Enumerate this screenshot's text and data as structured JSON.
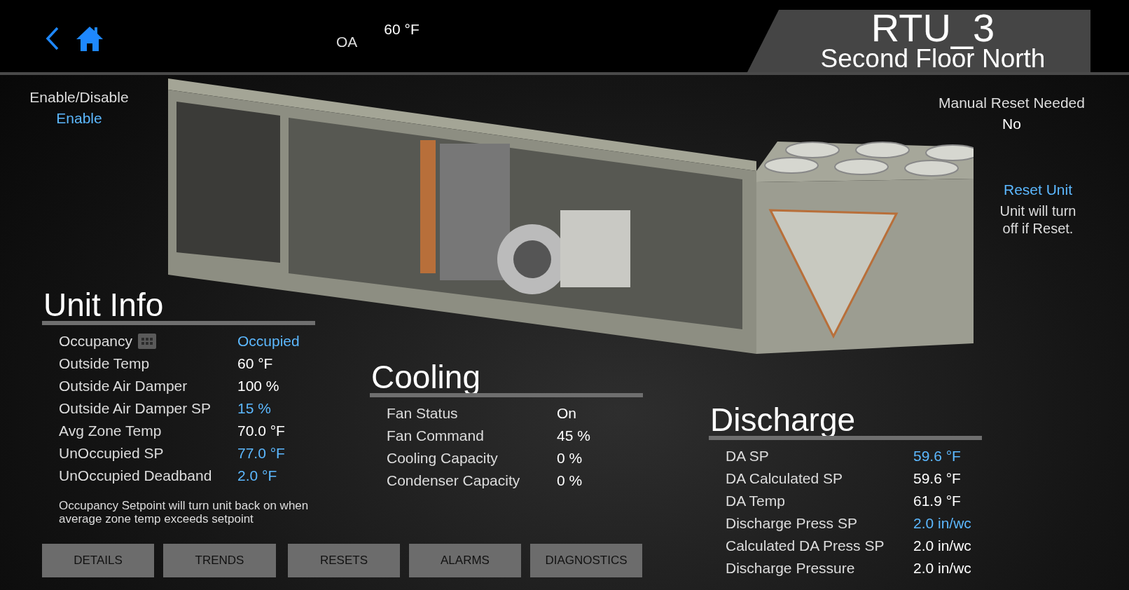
{
  "header": {
    "oa_label": "OA",
    "oa_value": "60 °F",
    "title": "RTU_3",
    "subtitle": "Second Floor North"
  },
  "enable": {
    "label": "Enable/Disable",
    "value": "Enable"
  },
  "manual_reset": {
    "label": "Manual Reset Needed",
    "value": "No"
  },
  "reset": {
    "link": "Reset Unit",
    "note": "Unit will turn off if Reset."
  },
  "unit_info": {
    "title": "Unit Info",
    "rows": [
      {
        "label": "Occupancy",
        "value": "Occupied",
        "editable": true,
        "schedule": true
      },
      {
        "label": "Outside Temp",
        "value": "60 °F",
        "editable": false
      },
      {
        "label": "Outside Air Damper",
        "value": "100 %",
        "editable": false
      },
      {
        "label": "Outside Air Damper SP",
        "value": "15 %",
        "editable": true
      },
      {
        "label": "Avg Zone Temp",
        "value": "70.0 °F",
        "editable": false
      },
      {
        "label": "UnOccupied SP",
        "value": "77.0 °F",
        "editable": true
      },
      {
        "label": "UnOccupied Deadband",
        "value": "2.0 °F",
        "editable": true
      }
    ],
    "note": "Occupancy Setpoint will turn unit back on when average zone temp exceeds setpoint"
  },
  "cooling": {
    "title": "Cooling",
    "rows": [
      {
        "label": "Fan Status",
        "value": "On",
        "editable": false
      },
      {
        "label": "Fan Command",
        "value": "45 %",
        "editable": false
      },
      {
        "label": "Cooling Capacity",
        "value": "0 %",
        "editable": false
      },
      {
        "label": "Condenser Capacity",
        "value": "0 %",
        "editable": false
      }
    ]
  },
  "discharge": {
    "title": "Discharge",
    "rows": [
      {
        "label": "DA SP",
        "value": "59.6 °F",
        "editable": true
      },
      {
        "label": "DA Calculated SP",
        "value": "59.6 °F",
        "editable": false
      },
      {
        "label": "DA Temp",
        "value": "61.9 °F",
        "editable": false
      },
      {
        "label": "Discharge Press SP",
        "value": "2.0 in/wc",
        "editable": true
      },
      {
        "label": "Calculated DA Press SP",
        "value": "2.0 in/wc",
        "editable": false
      },
      {
        "label": "Discharge Pressure",
        "value": "2.0 in/wc",
        "editable": false
      }
    ]
  },
  "buttons": [
    "DETAILS",
    "TRENDS",
    "RESETS",
    "ALARMS",
    "DIAGNOSTICS"
  ]
}
